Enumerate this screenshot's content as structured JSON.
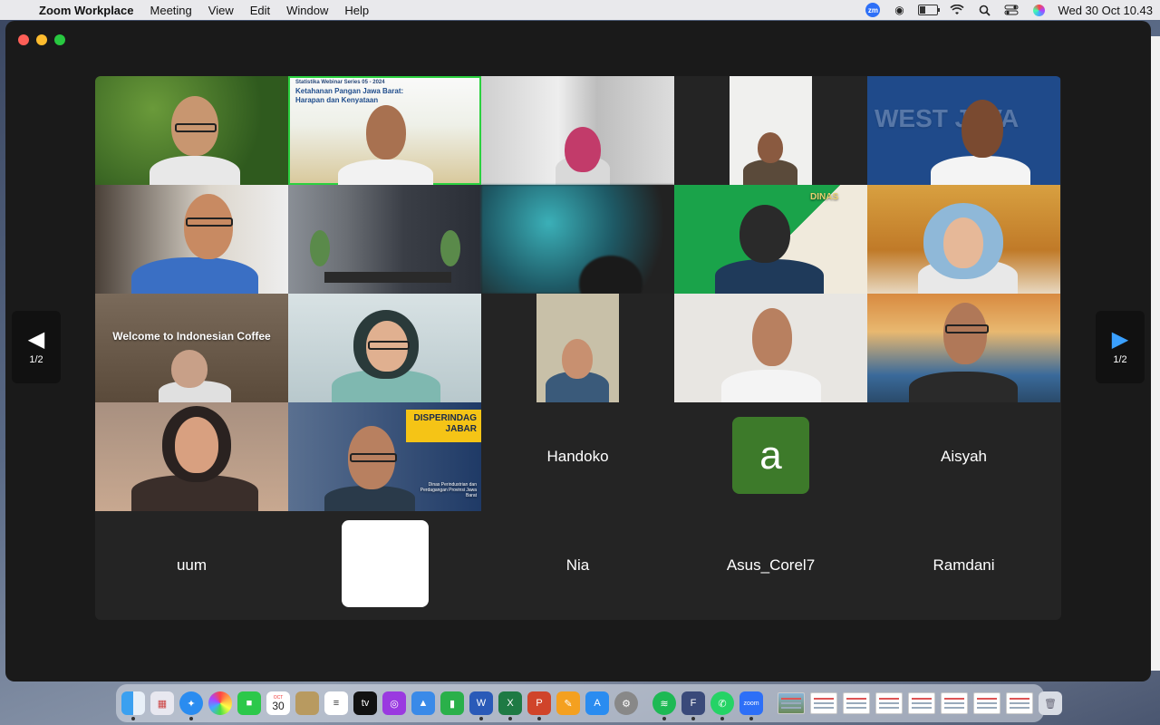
{
  "menubar": {
    "app_name": "Zoom Workplace",
    "items": [
      "Meeting",
      "View",
      "Edit",
      "Window",
      "Help"
    ],
    "status_badge": "zm",
    "clock": "Wed 30 Oct  10.43"
  },
  "window": {
    "pager_left": "1/2",
    "pager_right": "1/2"
  },
  "tiles": {
    "webinar_title": "Ketahanan Pangan Jawa Barat: Harapan dan Kenyataan",
    "webinar_series": "Statistika Webinar Series 05 - 2024",
    "west_java_bg": "WEST JAVA",
    "dinas_label": "DINAS",
    "coffee_caption": "Welcome to Indonesian Coffee",
    "disperindag": "DISPERINDAG JABAR",
    "disperindag_sub": "Dinas Perindustrian dan Perdagangan Provinsi Jawa Barat"
  },
  "participants": {
    "handoko": "Handoko",
    "avatar_letter": "a",
    "aisyah": "Aisyah",
    "uum": "uum",
    "nia": "Nia",
    "asus": "Asus_Corel7",
    "ramdani": "Ramdani"
  },
  "dock": {
    "calendar_month": "OCT",
    "calendar_day": "30",
    "tv_label": "tv",
    "zoom_label": "zoom"
  },
  "colors": {
    "active_speaker_border": "#2bd13f",
    "avatar_bg": "#3d7a2a",
    "pager_arrow_active": "#3aa0ff"
  }
}
